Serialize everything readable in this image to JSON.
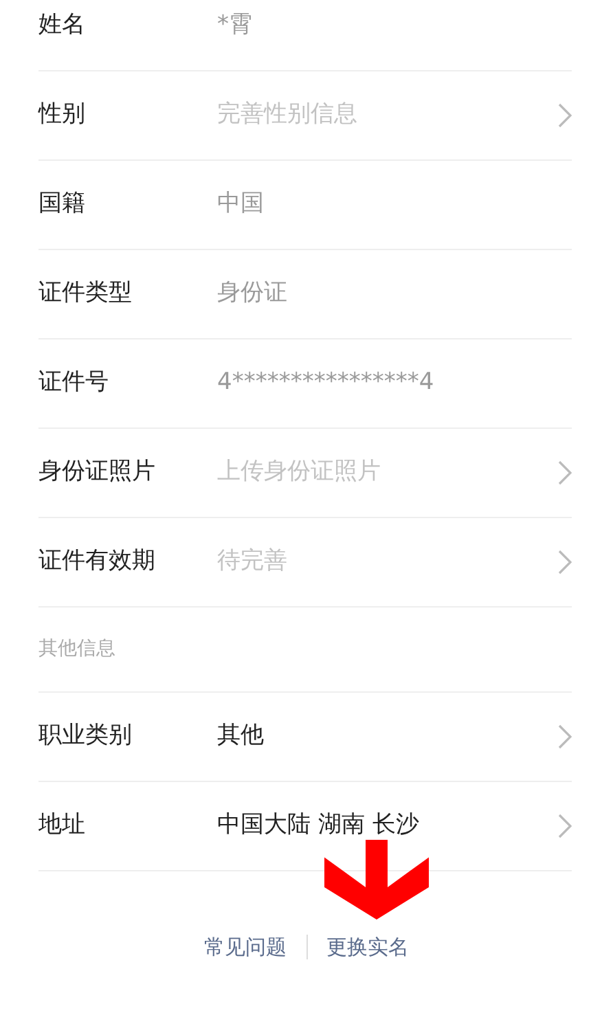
{
  "sections": [
    {
      "rows": [
        {
          "label": "姓名",
          "value": "*霄",
          "disabled": true,
          "chevron": false
        },
        {
          "label": "性别",
          "placeholder": "完善性别信息",
          "chevron": true
        },
        {
          "label": "国籍",
          "value": "中国",
          "disabled": true,
          "chevron": false
        },
        {
          "label": "证件类型",
          "value": "身份证",
          "disabled": true,
          "chevron": false
        },
        {
          "label": "证件号",
          "value": "4****************4",
          "disabled": true,
          "chevron": false
        },
        {
          "label": "身份证照片",
          "placeholder": "上传身份证照片",
          "chevron": true
        },
        {
          "label": "证件有效期",
          "placeholder": "待完善",
          "chevron": true
        }
      ]
    },
    {
      "title": "其他信息",
      "rows": [
        {
          "label": "职业类别",
          "value": "其他",
          "disabled": false,
          "chevron": true
        },
        {
          "label": "地址",
          "value": "中国大陆 湖南 长沙",
          "disabled": false,
          "chevron": true
        }
      ]
    }
  ],
  "footer_links": [
    "常见问题",
    "更换实名"
  ],
  "annotation": {
    "kind": "down-arrow"
  }
}
